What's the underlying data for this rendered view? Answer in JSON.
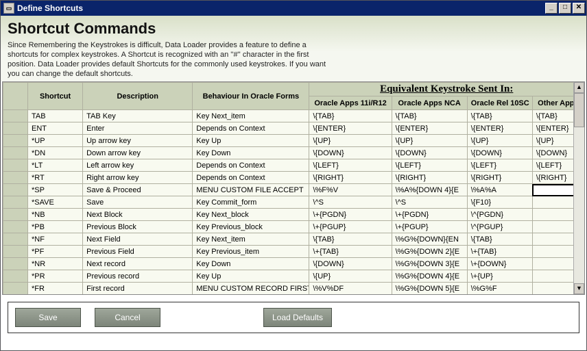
{
  "window": {
    "title": "Define Shortcuts"
  },
  "header": {
    "page_title": "Shortcut Commands",
    "intro": "Since Remembering the Keystrokes is difficult, Data Loader provides a feature to define a shortcuts for complex keystrokes. A Shortcut is recognized with an ''#'' character in the first position. Data Loader provides default Shortcuts for the commonly used keystrokes. If you want you can change the default shortcuts."
  },
  "grid": {
    "group_header": "Equivalent Keystroke  Sent In:",
    "columns": {
      "shortcut": "Shortcut",
      "description": "Description",
      "behaviour": "Behaviour In Oracle Forms",
      "apps11": "Oracle Apps 11i/R12",
      "appsnca": "Oracle Apps NCA",
      "rel10sc": "Oracle Rel 10SC",
      "other": "Other Apps"
    },
    "rows": [
      {
        "shortcut": "TAB",
        "description": "TAB Key",
        "behaviour": "Key Next_item",
        "apps11": "\\{TAB}",
        "appsnca": "\\{TAB}",
        "rel10sc": "\\{TAB}",
        "other": "\\{TAB}"
      },
      {
        "shortcut": "ENT",
        "description": "Enter",
        "behaviour": "Depends on Context",
        "apps11": "\\{ENTER}",
        "appsnca": "\\{ENTER}",
        "rel10sc": "\\{ENTER}",
        "other": "\\{ENTER}"
      },
      {
        "shortcut": "*UP",
        "description": "Up arrow key",
        "behaviour": "Key Up",
        "apps11": "\\{UP}",
        "appsnca": "\\{UP}",
        "rel10sc": "\\{UP}",
        "other": "\\{UP}"
      },
      {
        "shortcut": "*DN",
        "description": "Down arrow key",
        "behaviour": "Key Down",
        "apps11": "\\{DOWN}",
        "appsnca": "\\{DOWN}",
        "rel10sc": "\\{DOWN}",
        "other": "\\{DOWN}"
      },
      {
        "shortcut": "*LT",
        "description": "Left arrow key",
        "behaviour": "Depends on Context",
        "apps11": "\\{LEFT}",
        "appsnca": "\\{LEFT}",
        "rel10sc": "\\{LEFT}",
        "other": "\\{LEFT}"
      },
      {
        "shortcut": "*RT",
        "description": "Right arrow key",
        "behaviour": "Depends on Context",
        "apps11": "\\{RIGHT}",
        "appsnca": "\\{RIGHT}",
        "rel10sc": "\\{RIGHT}",
        "other": "\\{RIGHT}"
      },
      {
        "shortcut": "*SP",
        "description": "Save & Proceed",
        "behaviour": "MENU CUSTOM FILE ACCEPT",
        "apps11": "\\%F%V",
        "appsnca": "\\%A%{DOWN 4}{E",
        "rel10sc": "\\%A%A",
        "other": ""
      },
      {
        "shortcut": "*SAVE",
        "description": "Save",
        "behaviour": "Key Commit_form",
        "apps11": "\\^S",
        "appsnca": "\\^S",
        "rel10sc": "\\{F10}",
        "other": ""
      },
      {
        "shortcut": "*NB",
        "description": "Next Block",
        "behaviour": "Key Next_block",
        "apps11": "\\+{PGDN}",
        "appsnca": "\\+{PGDN}",
        "rel10sc": "\\^{PGDN}",
        "other": ""
      },
      {
        "shortcut": "*PB",
        "description": "Previous Block",
        "behaviour": "Key Previous_block",
        "apps11": "\\+{PGUP}",
        "appsnca": "\\+{PGUP}",
        "rel10sc": "\\^{PGUP}",
        "other": ""
      },
      {
        "shortcut": "*NF",
        "description": "Next Field",
        "behaviour": "Key Next_item",
        "apps11": "\\{TAB}",
        "appsnca": "\\%G%{DOWN}{EN",
        "rel10sc": "\\{TAB}",
        "other": ""
      },
      {
        "shortcut": "*PF",
        "description": "Previous Field",
        "behaviour": "Key Previous_item",
        "apps11": "\\+{TAB}",
        "appsnca": "\\%G%{DOWN 2}{E",
        "rel10sc": "\\+{TAB}",
        "other": ""
      },
      {
        "shortcut": "*NR",
        "description": "Next record",
        "behaviour": "Key Down",
        "apps11": "\\{DOWN}",
        "appsnca": "\\%G%{DOWN 3}{E",
        "rel10sc": "\\+{DOWN}",
        "other": ""
      },
      {
        "shortcut": "*PR",
        "description": "Previous record",
        "behaviour": "Key Up",
        "apps11": "\\{UP}",
        "appsnca": "\\%G%{DOWN 4}{E",
        "rel10sc": "\\+{UP}",
        "other": ""
      },
      {
        "shortcut": "*FR",
        "description": "First record",
        "behaviour": "MENU CUSTOM RECORD FIRST",
        "apps11": "\\%V%DF",
        "appsnca": "\\%G%{DOWN 5}{E",
        "rel10sc": "\\%G%F",
        "other": ""
      }
    ],
    "selected_cell": {
      "row_index": 6,
      "col": "other"
    }
  },
  "buttons": {
    "save": "Save",
    "cancel": "Cancel",
    "load_defaults": "Load Defaults"
  }
}
